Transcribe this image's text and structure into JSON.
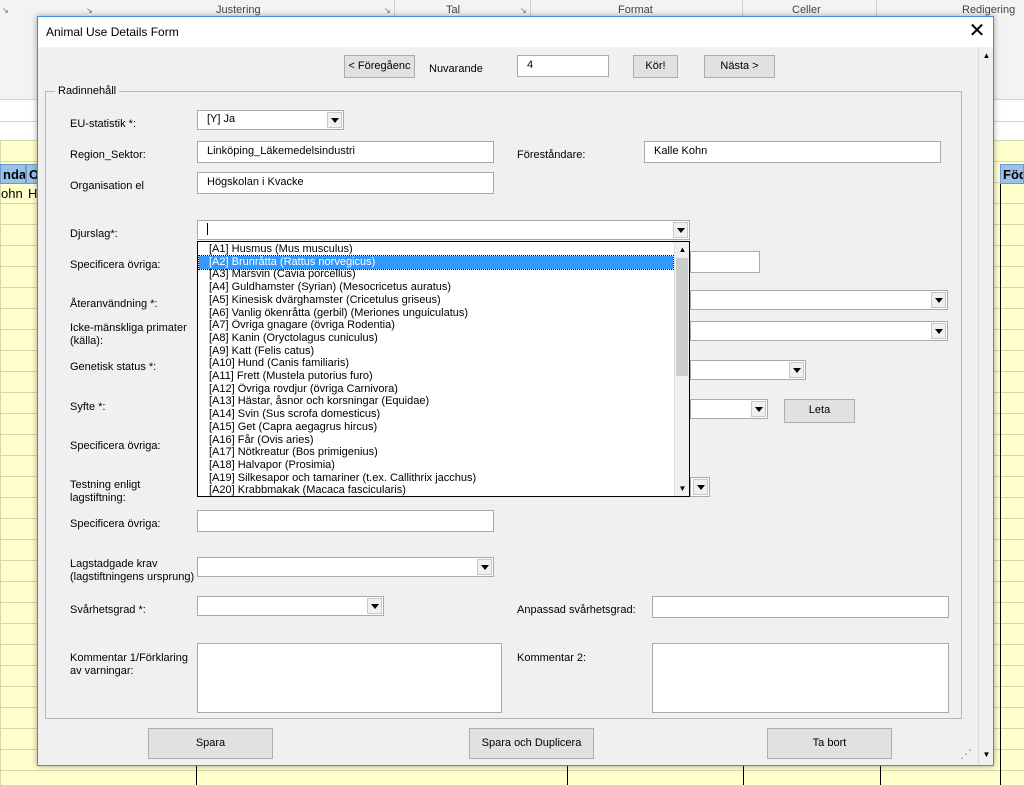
{
  "ribbon": {
    "groups": [
      "Justering",
      "Tal",
      "Format",
      "Celler",
      "Redigering"
    ]
  },
  "sheet": {
    "headers": [
      "ndar",
      "O",
      "Föd"
    ],
    "cells": [
      "ohn",
      "H"
    ]
  },
  "dialog": {
    "title": "Animal Use Details Form",
    "nav": {
      "prev_label": "< Föregåenc",
      "current_label": "Nuvarande",
      "current_value": "4",
      "go_label": "Kör!",
      "next_label": "Nästa  >"
    },
    "frame_title": "Radinnehåll",
    "fields": {
      "eu_stat": {
        "label": "EU-statistik *:",
        "value": "[Y] Ja"
      },
      "region": {
        "label": "Region_Sektor:",
        "value": "Linköping_Läkemedelsindustri"
      },
      "forestandare": {
        "label": "Föreståndare:",
        "value": "Kalle Kohn"
      },
      "organisation": {
        "label": "Organisation el",
        "value": "Högskolan i Kvacke"
      },
      "djurslag": {
        "label": "Djurslag*:",
        "value": ""
      },
      "spec1": {
        "label": "Specificera övriga:"
      },
      "ateranvandning": {
        "label": "Återanvändning *:"
      },
      "primater": {
        "label": "Icke-mänskliga primater (källa):"
      },
      "genetisk": {
        "label": "Genetisk status *:"
      },
      "syfte": {
        "label": "Syfte *:"
      },
      "leta_label": "Leta",
      "spec2": {
        "label": "Specificera övriga:"
      },
      "testning": {
        "label": "Testning enligt lagstiftning:"
      },
      "spec3": {
        "label": "Specificera övriga:",
        "value": ""
      },
      "lagstadgade": {
        "label": "Lagstadgade krav (lagstiftningens ursprung)"
      },
      "svarhetsgrad": {
        "label": "Svårhetsgrad *:"
      },
      "anpassad": {
        "label": "Anpassad svårhetsgrad:",
        "value": ""
      },
      "kommentar1": {
        "label": "Kommentar 1/Förklaring av varningar:"
      },
      "kommentar2": {
        "label": "Kommentar 2:"
      }
    },
    "dropdown_items": [
      "[A1] Husmus (Mus musculus)",
      "[A2] Brunråtta (Rattus norvegicus)",
      "[A3] Marsvin (Cavia porcellus)",
      "[A4] Guldhamster (Syrian) (Mesocricetus auratus)",
      "[A5] Kinesisk dvärghamster (Cricetulus griseus)",
      "[A6] Vanlig ökenråtta (gerbil) (Meriones unguiculatus)",
      "[A7] Övriga gnagare (övriga Rodentia)",
      "[A8] Kanin (Oryctolagus cuniculus)",
      "[A9] Katt (Felis catus)",
      "[A10] Hund (Canis familiaris)",
      "[A11] Frett (Mustela putorius furo)",
      "[A12] Övriga rovdjur (övriga Carnivora)",
      "[A13] Hästar, åsnor och korsningar (Equidae)",
      "[A14] Svin (Sus scrofa domesticus)",
      "[A15] Get (Capra aegagrus hircus)",
      "[A16] Får (Ovis aries)",
      "[A17] Nötkreatur (Bos primigenius)",
      "[A18] Halvapor (Prosimia)",
      "[A19] Silkesapor och tamariner (t.ex. Callithrix jacchus)",
      "[A20] Krabbmakak (Macaca fascicularis)"
    ],
    "selected_item": "[A2] Brunråtta (Rattus norvegicus)",
    "buttons": {
      "spara": "Spara",
      "spara_dup": "Spara och Duplicera",
      "ta_bort": "Ta bort"
    }
  },
  "colors": {
    "selection": "#3399ff",
    "header": "#9bc2e6",
    "cell": "#ffffcc",
    "accent_border": "#3a8ee6"
  }
}
